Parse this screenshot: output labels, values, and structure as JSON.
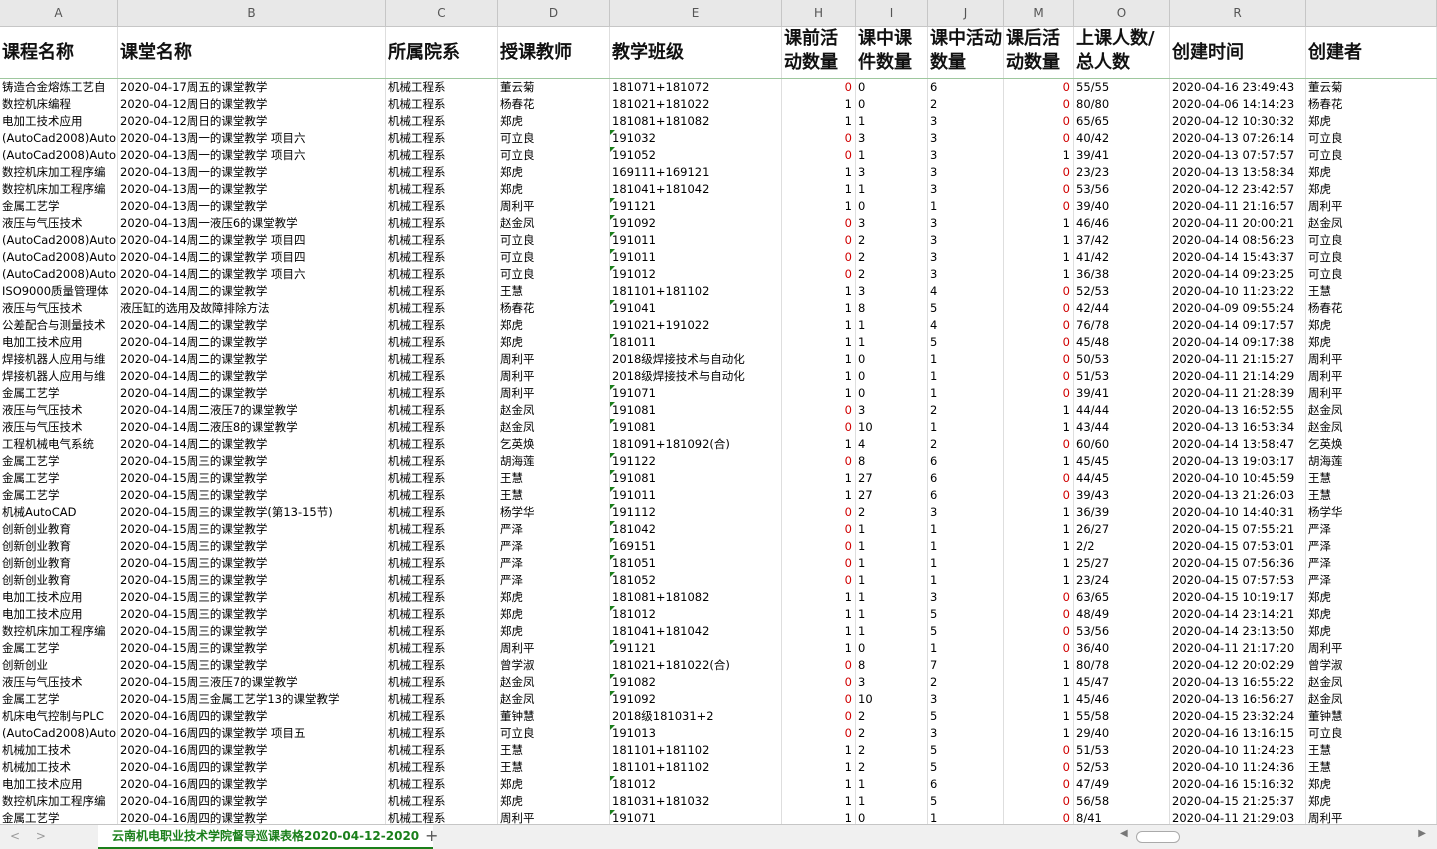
{
  "columns": [
    "A",
    "B",
    "C",
    "D",
    "E",
    "H",
    "I",
    "J",
    "M",
    "O",
    "R",
    ""
  ],
  "headers": [
    "课程名称",
    "课堂名称",
    "所属院系",
    "授课教师",
    "教学班级",
    "课前活动数量",
    "课中课件数量",
    "课中活动数量",
    "课后活动数量",
    "上课人数/总人数",
    "创建时间",
    "创建者"
  ],
  "rows": [
    [
      "铸造合金熔炼工艺自",
      "2020-04-17周五的课堂教学",
      "机械工程系",
      "董云菊",
      "181071+181072",
      "0",
      "0",
      "6",
      "0",
      "55/55",
      "2020-04-16 23:49:43",
      "董云菊"
    ],
    [
      "数控机床编程",
      "2020-04-12周日的课堂教学",
      "机械工程系",
      "杨春花",
      "181021+181022",
      "1",
      "0",
      "2",
      "0",
      "80/80",
      "2020-04-06 14:14:23",
      "杨春花"
    ],
    [
      "电加工技术应用",
      "2020-04-12周日的课堂教学",
      "机械工程系",
      "郑虎",
      "181081+181082",
      "1",
      "1",
      "3",
      "0",
      "65/65",
      "2020-04-12 10:30:32",
      "郑虎"
    ],
    [
      "(AutoCad2008)Auto",
      "2020-04-13周一的课堂教学 项目六",
      "机械工程系",
      "可立良",
      "191032",
      "0",
      "3",
      "3",
      "0",
      "40/42",
      "2020-04-13 07:26:14",
      "可立良"
    ],
    [
      "(AutoCad2008)Auto",
      "2020-04-13周一的课堂教学 项目六",
      "机械工程系",
      "可立良",
      "191052",
      "0",
      "1",
      "3",
      "1",
      "39/41",
      "2020-04-13 07:57:57",
      "可立良"
    ],
    [
      "数控机床加工程序编",
      "2020-04-13周一的课堂教学",
      "机械工程系",
      "郑虎",
      "169111+169121",
      "1",
      "3",
      "3",
      "0",
      "23/23",
      "2020-04-13 13:58:34",
      "郑虎"
    ],
    [
      "数控机床加工程序编",
      "2020-04-13周一的课堂教学",
      "机械工程系",
      "郑虎",
      "181041+181042",
      "1",
      "1",
      "3",
      "0",
      "53/56",
      "2020-04-12 23:42:57",
      "郑虎"
    ],
    [
      "金属工艺学",
      "2020-04-13周一的课堂教学",
      "机械工程系",
      "周利平",
      "191121",
      "1",
      "0",
      "1",
      "0",
      "39/40",
      "2020-04-11 21:16:57",
      "周利平"
    ],
    [
      "液压与气压技术",
      "2020-04-13周一液压6的课堂教学",
      "机械工程系",
      "赵金凤",
      "191092",
      "0",
      "3",
      "3",
      "1",
      "46/46",
      "2020-04-11 20:00:21",
      "赵金凤"
    ],
    [
      "(AutoCad2008)Auto",
      "2020-04-14周二的课堂教学 项目四",
      "机械工程系",
      "可立良",
      "191011",
      "0",
      "2",
      "3",
      "1",
      "37/42",
      "2020-04-14 08:56:23",
      "可立良"
    ],
    [
      "(AutoCad2008)Auto",
      "2020-04-14周二的课堂教学 项目四",
      "机械工程系",
      "可立良",
      "191011",
      "0",
      "2",
      "3",
      "1",
      "41/42",
      "2020-04-14 15:43:37",
      "可立良"
    ],
    [
      "(AutoCad2008)Auto",
      "2020-04-14周二的课堂教学 项目六",
      "机械工程系",
      "可立良",
      "191012",
      "0",
      "2",
      "3",
      "1",
      "36/38",
      "2020-04-14 09:23:25",
      "可立良"
    ],
    [
      "ISO9000质量管理体",
      "2020-04-14周二的课堂教学",
      "机械工程系",
      "王慧",
      "181101+181102",
      "1",
      "3",
      "4",
      "0",
      "52/53",
      "2020-04-10 11:23:22",
      "王慧"
    ],
    [
      "液压与气压技术",
      "液压缸的选用及故障排除方法",
      "机械工程系",
      "杨春花",
      "191041",
      "1",
      "8",
      "5",
      "0",
      "42/44",
      "2020-04-09 09:55:24",
      "杨春花"
    ],
    [
      "公差配合与测量技术",
      "2020-04-14周二的课堂教学",
      "机械工程系",
      "郑虎",
      "191021+191022",
      "1",
      "1",
      "4",
      "0",
      "76/78",
      "2020-04-14 09:17:57",
      "郑虎"
    ],
    [
      "电加工技术应用",
      "2020-04-14周二的课堂教学",
      "机械工程系",
      "郑虎",
      "181011",
      "1",
      "1",
      "5",
      "0",
      "45/48",
      "2020-04-14 09:17:38",
      "郑虎"
    ],
    [
      "焊接机器人应用与维",
      "2020-04-14周二的课堂教学",
      "机械工程系",
      "周利平",
      "2018级焊接技术与自动化",
      "1",
      "0",
      "1",
      "0",
      "50/53",
      "2020-04-11 21:15:27",
      "周利平"
    ],
    [
      "焊接机器人应用与维",
      "2020-04-14周二的课堂教学",
      "机械工程系",
      "周利平",
      "2018级焊接技术与自动化",
      "1",
      "0",
      "1",
      "0",
      "51/53",
      "2020-04-11 21:14:29",
      "周利平"
    ],
    [
      "金属工艺学",
      "2020-04-14周二的课堂教学",
      "机械工程系",
      "周利平",
      "191071",
      "1",
      "0",
      "1",
      "0",
      "39/41",
      "2020-04-11 21:28:39",
      "周利平"
    ],
    [
      "液压与气压技术",
      "2020-04-14周二液压7的课堂教学",
      "机械工程系",
      "赵金凤",
      "191081",
      "0",
      "3",
      "2",
      "1",
      "44/44",
      "2020-04-13 16:52:55",
      "赵金凤"
    ],
    [
      "液压与气压技术",
      "2020-04-14周二液压8的课堂教学",
      "机械工程系",
      "赵金凤",
      "191081",
      "0",
      "10",
      "1",
      "1",
      "43/44",
      "2020-04-13 16:53:34",
      "赵金凤"
    ],
    [
      "工程机械电气系统",
      "2020-04-14周二的课堂教学",
      "机械工程系",
      "乞英焕",
      "181091+181092(合)",
      "1",
      "4",
      "2",
      "0",
      "60/60",
      "2020-04-14 13:58:47",
      "乞英焕"
    ],
    [
      "金属工艺学",
      "2020-04-15周三的课堂教学",
      "机械工程系",
      "胡海莲",
      "191122",
      "0",
      "8",
      "6",
      "1",
      "45/45",
      "2020-04-13 19:03:17",
      "胡海莲"
    ],
    [
      "金属工艺学",
      "2020-04-15周三的课堂教学",
      "机械工程系",
      "王慧",
      "191081",
      "1",
      "27",
      "6",
      "0",
      "44/45",
      "2020-04-10 10:45:59",
      "王慧"
    ],
    [
      "金属工艺学",
      "2020-04-15周三的课堂教学",
      "机械工程系",
      "王慧",
      "191011",
      "1",
      "27",
      "6",
      "0",
      "39/43",
      "2020-04-13 21:26:03",
      "王慧"
    ],
    [
      "机械AutoCAD",
      "2020-04-15周三的课堂教学(第13-15节)",
      "机械工程系",
      "杨学华",
      "191112",
      "0",
      "2",
      "3",
      "1",
      "36/39",
      "2020-04-10 14:40:31",
      "杨学华"
    ],
    [
      "创新创业教育",
      "2020-04-15周三的课堂教学",
      "机械工程系",
      "严泽",
      "181042",
      "0",
      "1",
      "1",
      "1",
      "26/27",
      "2020-04-15 07:55:21",
      "严泽"
    ],
    [
      "创新创业教育",
      "2020-04-15周三的课堂教学",
      "机械工程系",
      "严泽",
      "169151",
      "0",
      "1",
      "1",
      "1",
      "2/2",
      "2020-04-15 07:53:01",
      "严泽"
    ],
    [
      "创新创业教育",
      "2020-04-15周三的课堂教学",
      "机械工程系",
      "严泽",
      "181051",
      "0",
      "1",
      "1",
      "1",
      "25/27",
      "2020-04-15 07:56:36",
      "严泽"
    ],
    [
      "创新创业教育",
      "2020-04-15周三的课堂教学",
      "机械工程系",
      "严泽",
      "181052",
      "0",
      "1",
      "1",
      "1",
      "23/24",
      "2020-04-15 07:57:53",
      "严泽"
    ],
    [
      "电加工技术应用",
      "2020-04-15周三的课堂教学",
      "机械工程系",
      "郑虎",
      "181081+181082",
      "1",
      "1",
      "3",
      "0",
      "63/65",
      "2020-04-15 10:19:17",
      "郑虎"
    ],
    [
      "电加工技术应用",
      "2020-04-15周三的课堂教学",
      "机械工程系",
      "郑虎",
      "181012",
      "1",
      "1",
      "5",
      "0",
      "48/49",
      "2020-04-14 23:14:21",
      "郑虎"
    ],
    [
      "数控机床加工程序编",
      "2020-04-15周三的课堂教学",
      "机械工程系",
      "郑虎",
      "181041+181042",
      "1",
      "1",
      "5",
      "0",
      "53/56",
      "2020-04-14 23:13:50",
      "郑虎"
    ],
    [
      "金属工艺学",
      "2020-04-15周三的课堂教学",
      "机械工程系",
      "周利平",
      "191121",
      "1",
      "0",
      "1",
      "0",
      "36/40",
      "2020-04-11 21:17:20",
      "周利平"
    ],
    [
      "创新创业",
      "2020-04-15周三的课堂教学",
      "机械工程系",
      "曾学淑",
      "181021+181022(合)",
      "0",
      "8",
      "7",
      "1",
      "80/78",
      "2020-04-12 20:02:29",
      "曾学淑"
    ],
    [
      "液压与气压技术",
      "2020-04-15周三液压7的课堂教学",
      "机械工程系",
      "赵金凤",
      "191082",
      "0",
      "3",
      "2",
      "1",
      "45/47",
      "2020-04-13 16:55:22",
      "赵金凤"
    ],
    [
      "金属工艺学",
      "2020-04-15周三金属工艺学13的课堂教学",
      "机械工程系",
      "赵金凤",
      "191092",
      "0",
      "10",
      "3",
      "1",
      "45/46",
      "2020-04-13 16:56:27",
      "赵金凤"
    ],
    [
      "机床电气控制与PLC",
      "2020-04-16周四的课堂教学",
      "机械工程系",
      "董钟慧",
      "2018级181031+2",
      "0",
      "2",
      "5",
      "1",
      "55/58",
      "2020-04-15 23:32:24",
      "董钟慧"
    ],
    [
      "(AutoCad2008)Auto",
      "2020-04-16周四的课堂教学 项目五",
      "机械工程系",
      "可立良",
      "191013",
      "0",
      "2",
      "3",
      "1",
      "29/40",
      "2020-04-16 13:16:15",
      "可立良"
    ],
    [
      "机械加工技术",
      "2020-04-16周四的课堂教学",
      "机械工程系",
      "王慧",
      "181101+181102",
      "1",
      "2",
      "5",
      "0",
      "51/53",
      "2020-04-10 11:24:23",
      "王慧"
    ],
    [
      "机械加工技术",
      "2020-04-16周四的课堂教学",
      "机械工程系",
      "王慧",
      "181101+181102",
      "1",
      "2",
      "5",
      "0",
      "52/53",
      "2020-04-10 11:24:36",
      "王慧"
    ],
    [
      "电加工技术应用",
      "2020-04-16周四的课堂教学",
      "机械工程系",
      "郑虎",
      "181012",
      "1",
      "1",
      "6",
      "0",
      "47/49",
      "2020-04-16 15:16:32",
      "郑虎"
    ],
    [
      "数控机床加工程序编",
      "2020-04-16周四的课堂教学",
      "机械工程系",
      "郑虎",
      "181031+181032",
      "1",
      "1",
      "5",
      "0",
      "56/58",
      "2020-04-15 21:25:37",
      "郑虎"
    ],
    [
      "金属工艺学",
      "2020-04-16周四的课堂教学",
      "机械工程系",
      "周利平",
      "191071",
      "1",
      "0",
      "1",
      "0",
      "8/41",
      "2020-04-11 21:29:03",
      "周利平"
    ]
  ],
  "sheet_tab": "云南机电职业技术学院督导巡课表格2020-04-12-2020",
  "add_sheet": "+",
  "nav_arrows": "< >",
  "colors": {
    "header_bg": "#e8e8e8",
    "tab_green": "#1a7f1a",
    "zero_red": "#d00000"
  }
}
